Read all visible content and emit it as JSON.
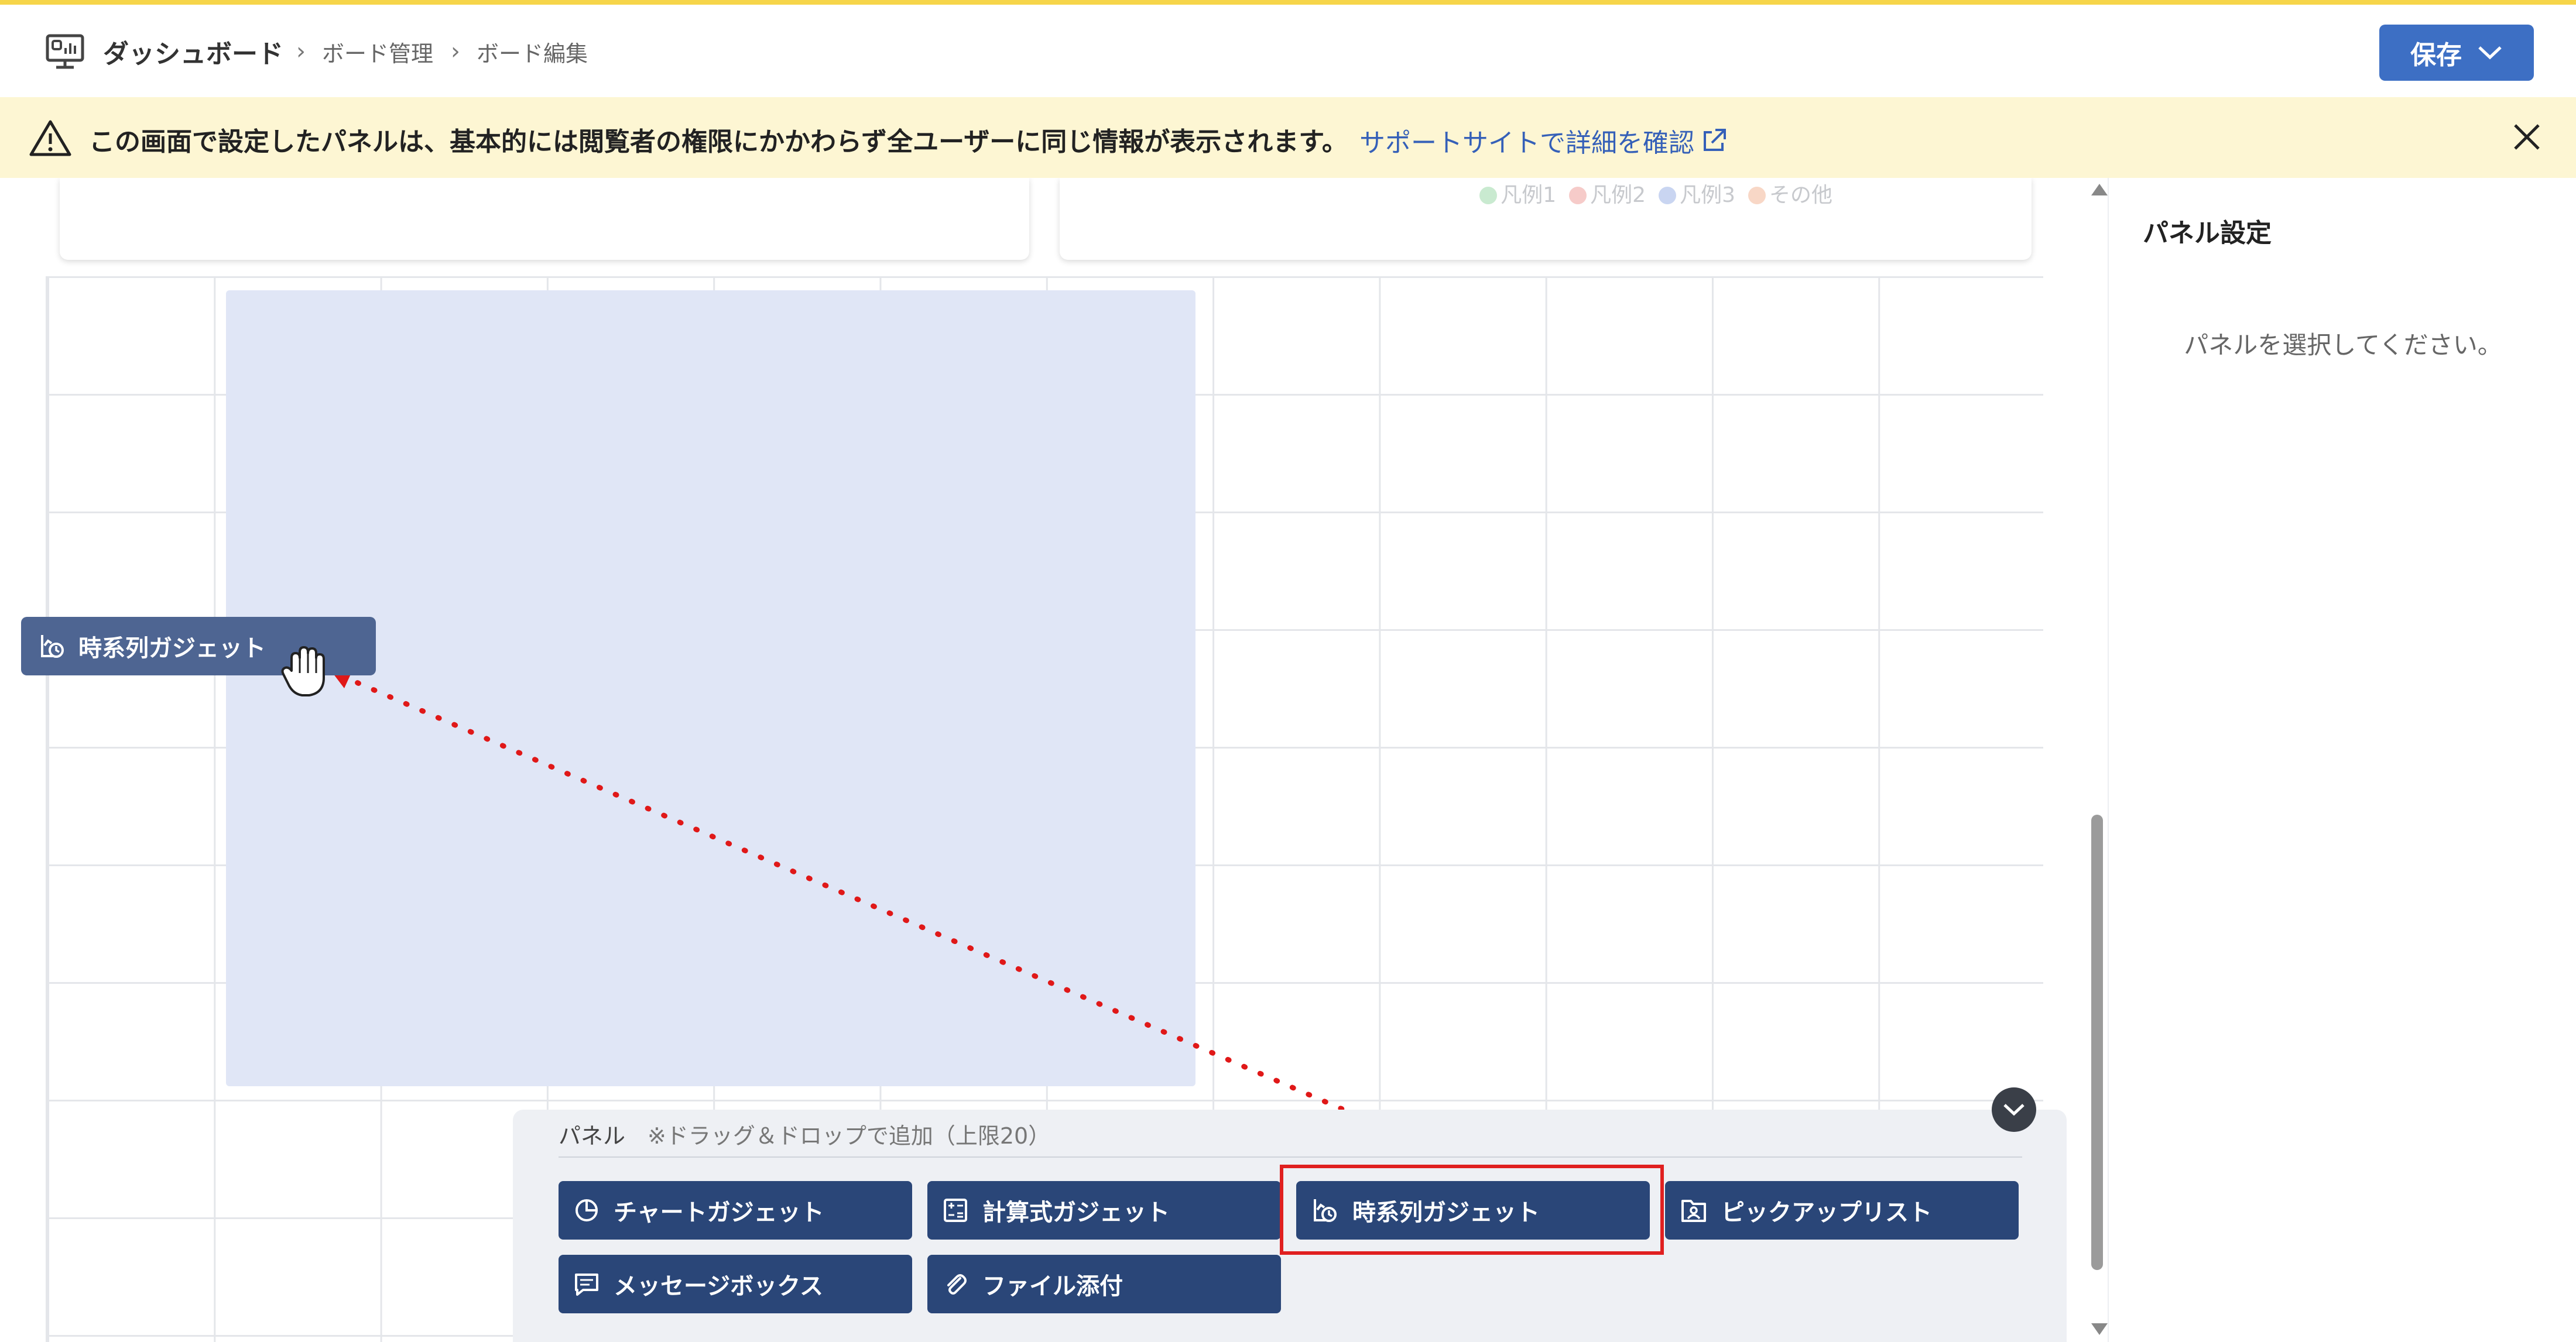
{
  "breadcrumb": {
    "root": "ダッシュボード",
    "items": [
      "ボード管理",
      "ボード編集"
    ]
  },
  "header": {
    "save_label": "保存"
  },
  "notice": {
    "text": "この画面で設定したパネルは、基本的には閲覧者の権限にかかわらず全ユーザーに同じ情報が表示されます。",
    "link": "サポートサイトで詳細を確認"
  },
  "legend": [
    {
      "label": "凡例1",
      "color": "#c9ead0"
    },
    {
      "label": "凡例2",
      "color": "#f6cbc9"
    },
    {
      "label": "凡例3",
      "color": "#c9d5f1"
    },
    {
      "label": "その他",
      "color": "#f8d7c6"
    }
  ],
  "drag_chip": {
    "label": "時系列ガジェット"
  },
  "sidebar": {
    "title": "パネル設定",
    "empty_message": "パネルを選択してください。"
  },
  "palette": {
    "title": "パネル",
    "hint": "※ドラッグ＆ドロップで追加（上限20）",
    "gadgets": [
      {
        "label": "チャートガジェット",
        "icon": "pie-chart-icon"
      },
      {
        "label": "計算式ガジェット",
        "icon": "calculator-icon"
      },
      {
        "label": "時系列ガジェット",
        "icon": "time-series-icon"
      },
      {
        "label": "ピックアップリスト",
        "icon": "pickup-list-icon"
      },
      {
        "label": "メッセージボックス",
        "icon": "message-icon"
      },
      {
        "label": "ファイル添付",
        "icon": "paperclip-icon"
      }
    ]
  },
  "colors": {
    "accent": "#3d6fc4",
    "gadget_button": "#2a4678",
    "drop_zone": "#e0e6f6",
    "notice_bg": "#fdf6d3",
    "highlight": "#e02020"
  }
}
